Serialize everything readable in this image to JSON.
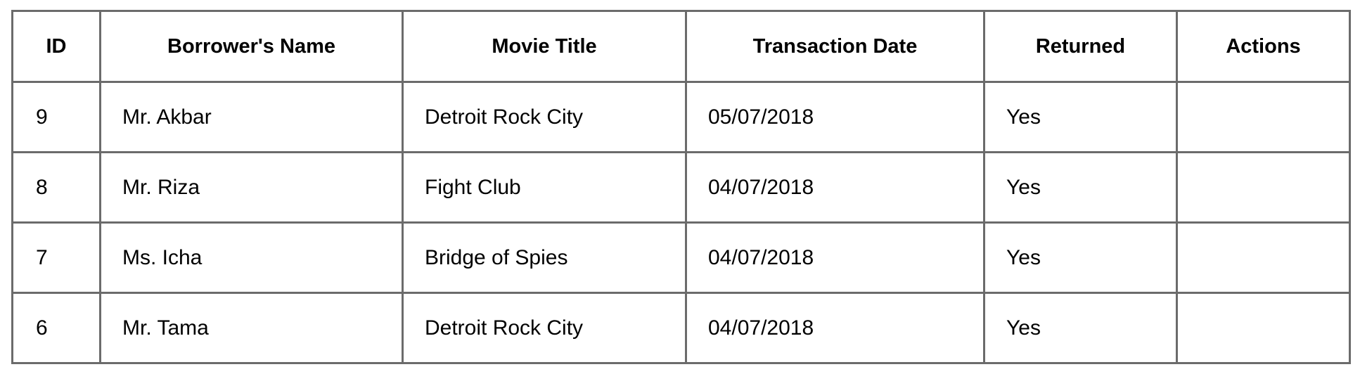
{
  "table": {
    "headers": [
      "ID",
      "Borrower's Name",
      "Movie Title",
      "Transaction Date",
      "Returned",
      "Actions"
    ],
    "rows": [
      {
        "id": "9",
        "name": "Mr. Akbar",
        "movie": "Detroit Rock City",
        "date": "05/07/2018",
        "returned": "Yes",
        "actions": ""
      },
      {
        "id": "8",
        "name": "Mr. Riza",
        "movie": "Fight Club",
        "date": "04/07/2018",
        "returned": "Yes",
        "actions": ""
      },
      {
        "id": "7",
        "name": "Ms. Icha",
        "movie": "Bridge of Spies",
        "date": "04/07/2018",
        "returned": "Yes",
        "actions": ""
      },
      {
        "id": "6",
        "name": "Mr. Tama",
        "movie": "Detroit Rock City",
        "date": "04/07/2018",
        "returned": "Yes",
        "actions": ""
      }
    ]
  }
}
